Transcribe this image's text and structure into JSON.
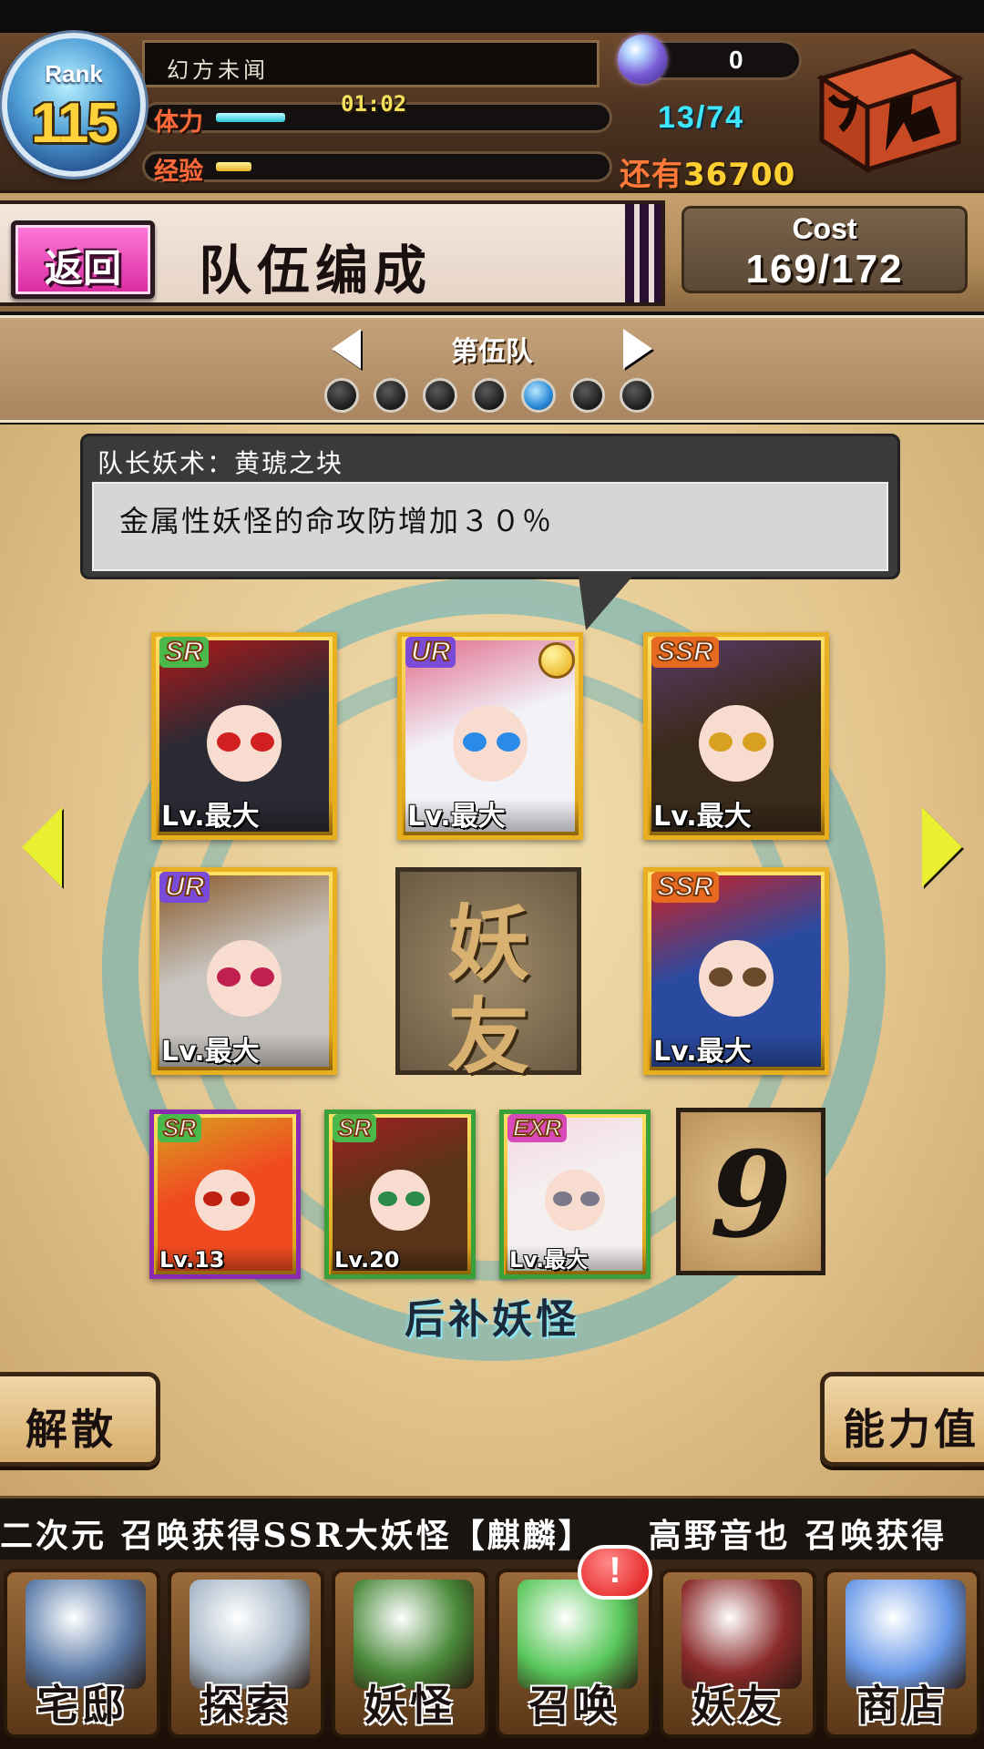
{
  "header": {
    "rank_label": "Rank",
    "rank_value": "115",
    "player_name": "幻方未闻",
    "stamina_label": "体力",
    "stamina_timer": "01:02",
    "stamina_value": "13/74",
    "stamina_fraction": 0.176,
    "exp_label": "经验",
    "exp_fraction": 0.09,
    "exp_remaining_prefix": "还有",
    "exp_remaining_value": "36700",
    "orb_count": "0",
    "orb_icon": "spirit-orb-icon",
    "chest_icon": "treasure-chest-icon"
  },
  "title_bar": {
    "back_label": "返回",
    "title": "队伍编成",
    "cost_label": "Cost",
    "cost_value": "169/172"
  },
  "team_selector": {
    "team_name": "第伍队",
    "total_teams": 7,
    "active_index": 4
  },
  "leader": {
    "skill_title": "队长妖术：黄琥之块",
    "skill_desc": "金属性妖怪的命攻防增加３０％"
  },
  "team_cards": [
    {
      "rarity": "SR",
      "level": "Lv.最大",
      "leader": false,
      "frame": "#e8b020",
      "hair": "#2a2a34",
      "eye": "#d02020",
      "accent": "#b01818"
    },
    {
      "rarity": "UR",
      "level": "Lv.最大",
      "leader": true,
      "frame": "#e8b020",
      "hair": "#f2f2f8",
      "eye": "#2a8ae8",
      "accent": "#e06a8a"
    },
    {
      "rarity": "SSR",
      "level": "Lv.最大",
      "leader": false,
      "frame": "#e8b020",
      "hair": "#3a2a1a",
      "eye": "#d8a020",
      "accent": "#5a3a6a"
    },
    {
      "rarity": "UR",
      "level": "Lv.最大",
      "leader": false,
      "frame": "#e8b020",
      "hair": "#c8c4c0",
      "eye": "#c02050",
      "accent": "#8a5a2a"
    },
    {
      "rarity": "SSR",
      "level": "Lv.最大",
      "leader": false,
      "frame": "#e8b020",
      "hair": "#2a4aa0",
      "eye": "#6a4a2a",
      "accent": "#d02020"
    }
  ],
  "friend_slot": {
    "char_top": "妖",
    "char_bottom": "友"
  },
  "reserve_cards": [
    {
      "rarity": "SR",
      "level": "Lv.13",
      "frame": "#8a2ab0",
      "hair": "#f04a20",
      "eye": "#c02010",
      "accent": "#d8a020"
    },
    {
      "rarity": "SR",
      "level": "Lv.20",
      "frame": "#3aa03a",
      "hair": "#5a3418",
      "eye": "#2a8a4a",
      "accent": "#a02020"
    },
    {
      "rarity": "EXR",
      "level": "Lv.最大",
      "frame": "#3aa03a",
      "hair": "#f4f0f0",
      "eye": "#7a7a8a",
      "accent": "#f4d8e0"
    }
  ],
  "reserve_slot_number": "9",
  "reserve_title": "后补妖怪",
  "buttons": {
    "disband": "解散",
    "stats": "能力值"
  },
  "ticker": "二次元 召唤获得SSR大妖怪【麒麟】　　高野音也 召唤获得",
  "nav": [
    {
      "label": "宅邸",
      "icon": "mansion-icon",
      "color": "#5a7aa8"
    },
    {
      "label": "探索",
      "icon": "magnifier-map-icon",
      "color": "#a8b8c8"
    },
    {
      "label": "妖怪",
      "icon": "scroll-icon",
      "color": "#4a8a3a"
    },
    {
      "label": "召唤",
      "icon": "pentagram-icon",
      "color": "#5ac85a"
    },
    {
      "label": "妖友",
      "icon": "fox-girl-icon",
      "color": "#8a2a2a"
    },
    {
      "label": "商店",
      "icon": "crystal-ball-icon",
      "color": "#6a9ae8"
    }
  ],
  "notice_badge": "!"
}
